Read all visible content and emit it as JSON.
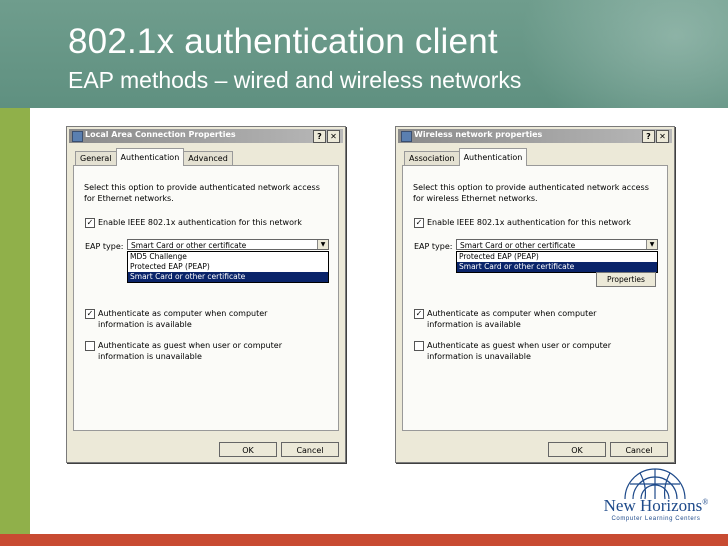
{
  "slide": {
    "title": "802.1x authentication client",
    "subtitle": "EAP methods – wired and wireless networks"
  },
  "left_dialog": {
    "title": "Local Area Connection Properties",
    "help_glyph": "?",
    "close_glyph": "✕",
    "tabs": [
      "General",
      "Authentication",
      "Advanced"
    ],
    "active_tab": "Authentication",
    "description": "Select this option to provide authenticated network access for Ethernet networks.",
    "enable_checkbox": {
      "label": "Enable IEEE 802.1x authentication for this network",
      "checked": true
    },
    "eap_label": "EAP type:",
    "eap_selected": "Smart Card or other certificate",
    "eap_options": [
      "MD5 Challenge",
      "Protected EAP (PEAP)",
      "Smart Card or other certificate"
    ],
    "auth_computer": {
      "label": "Authenticate as computer when computer information is available",
      "checked": true
    },
    "auth_guest": {
      "label": "Authenticate as guest when user or computer information is unavailable",
      "checked": false
    },
    "ok_label": "OK",
    "cancel_label": "Cancel"
  },
  "right_dialog": {
    "title": "Wireless network properties",
    "help_glyph": "?",
    "close_glyph": "✕",
    "tabs": [
      "Association",
      "Authentication"
    ],
    "active_tab": "Authentication",
    "description": "Select this option to provide authenticated network access for wireless Ethernet networks.",
    "enable_checkbox": {
      "label": "Enable IEEE 802.1x authentication for this network",
      "checked": true
    },
    "eap_label": "EAP type:",
    "eap_selected": "Smart Card or other certificate",
    "eap_options": [
      "Protected EAP (PEAP)",
      "Smart Card or other certificate"
    ],
    "properties_label": "Properties",
    "auth_computer": {
      "label": "Authenticate as computer when computer information is available",
      "checked": true
    },
    "auth_guest": {
      "label": "Authenticate as guest when user or computer information is unavailable",
      "checked": false
    },
    "ok_label": "OK",
    "cancel_label": "Cancel"
  },
  "logo": {
    "name": "New Horizons",
    "mark": "®",
    "tagline": "Computer Learning Centers"
  },
  "colors": {
    "header_bg": "#6f9d8d",
    "left_bar": "#90b04a",
    "bottom_bar": "#c84b32",
    "selection": "#0a246a",
    "logo_blue": "#1e4a8a"
  },
  "icons": {
    "check": "✓",
    "dropdown": "▼"
  }
}
